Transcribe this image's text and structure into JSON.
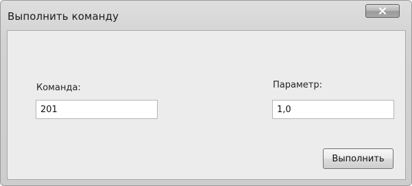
{
  "window": {
    "title": "Выполнить команду"
  },
  "form": {
    "command_label": "Команда:",
    "command_value": "201",
    "parameter_label": "Параметр:",
    "parameter_value": "1,0",
    "run_button_label": "Выполнить"
  },
  "icons": {
    "close": "close-icon"
  }
}
